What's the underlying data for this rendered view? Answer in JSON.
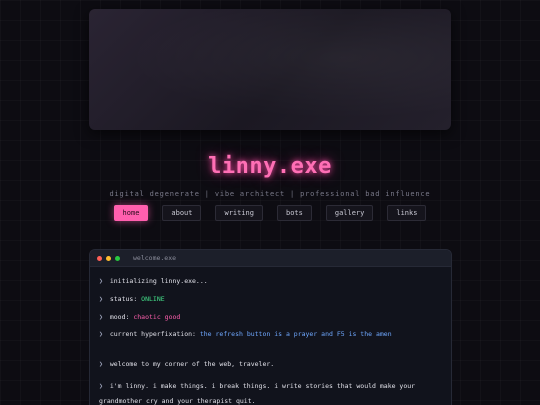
{
  "header": {
    "title": "linny.exe",
    "tagline": "digital degenerate | vibe architect | professional bad influence"
  },
  "nav": {
    "items": [
      {
        "label": "home",
        "active": true
      },
      {
        "label": "about",
        "active": false
      },
      {
        "label": "writing",
        "active": false
      },
      {
        "label": "bots",
        "active": false
      },
      {
        "label": "gallery",
        "active": false
      },
      {
        "label": "links",
        "active": false
      }
    ]
  },
  "terminal": {
    "title": "welcome.exe",
    "prompt": "❯",
    "line1": "initializing linny.exe...",
    "status_label": "status:",
    "status_value": "ONLINE",
    "mood_label": "mood:",
    "mood_value": "chaotic good",
    "hyper_label": "current hyperfixation:",
    "hyper_value": "the refresh button is a prayer and F5 is the amen",
    "welcome": "welcome to my corner of the web, traveler.",
    "intro": "i'm linny. i make things. i break things. i write stories that would make your grandmother cry and your therapist quit."
  },
  "colors": {
    "accent": "#ff5fae",
    "status_green": "#44e08a",
    "highlight_blue": "#6fa8ff"
  }
}
